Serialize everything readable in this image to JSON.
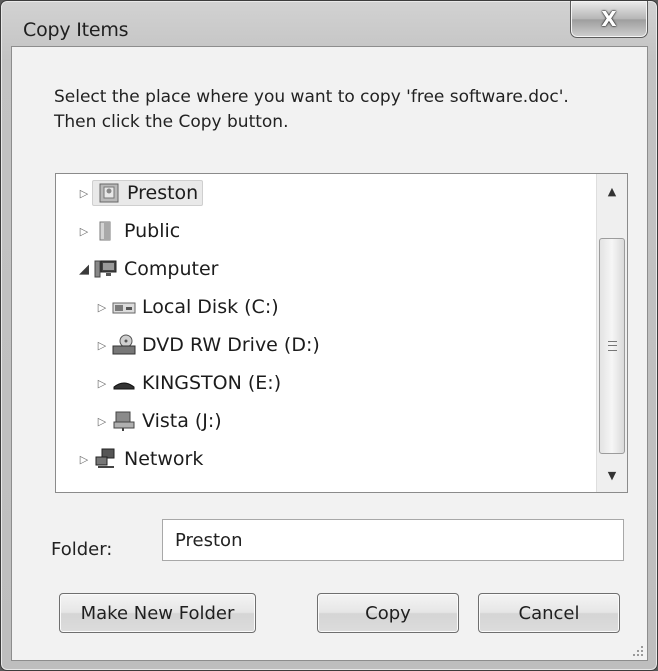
{
  "window": {
    "title": "Copy Items",
    "close_glyph": "X"
  },
  "instruction": "Select the place where you want to copy 'free software.doc'. Then click the Copy button.",
  "tree": {
    "items": [
      {
        "label": "Preston",
        "icon": "user-folder-icon",
        "expander": "▷",
        "selected": true
      },
      {
        "label": "Public",
        "icon": "folder-icon",
        "expander": "▷"
      },
      {
        "label": "Computer",
        "icon": "computer-icon",
        "expander": "◢"
      },
      {
        "label": "Local Disk (C:)",
        "icon": "hard-disk-icon",
        "expander": "▷"
      },
      {
        "label": "DVD RW Drive (D:)",
        "icon": "dvd-drive-icon",
        "expander": "▷"
      },
      {
        "label": "KINGSTON (E:)",
        "icon": "usb-drive-icon",
        "expander": "▷"
      },
      {
        "label": "Vista (J:)",
        "icon": "network-drive-icon",
        "expander": "▷"
      },
      {
        "label": "Network",
        "icon": "network-icon",
        "expander": "▷"
      }
    ],
    "scroll_up": "▲",
    "scroll_down": "▼"
  },
  "folder": {
    "label": "Folder:",
    "value": "Preston"
  },
  "buttons": {
    "make_new_folder": "Make New Folder",
    "copy": "Copy",
    "cancel": "Cancel"
  }
}
